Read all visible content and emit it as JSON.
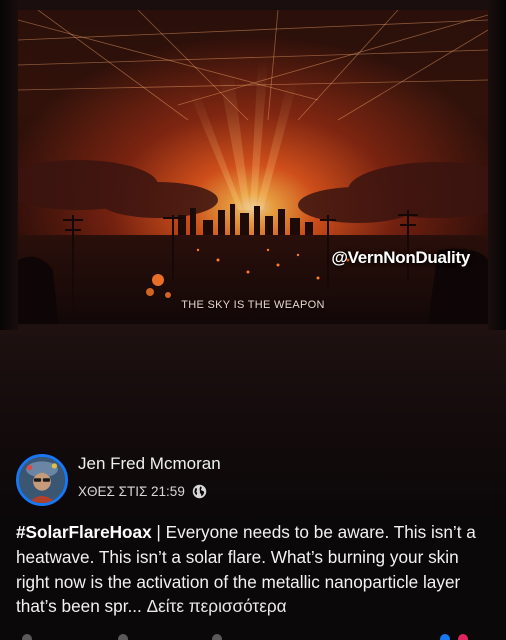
{
  "media": {
    "watermark": "@VernNonDuality",
    "overlay_caption": "THE SKY IS THE WEAPON"
  },
  "post": {
    "author": "Jen Fred Mcmoran",
    "timestamp": "ΧΘΕΣ ΣΤΙΣ 21:59",
    "privacy_icon": "globe-icon",
    "hashtag": "#SolarFlareHoax",
    "text": " | Everyone needs to be aware. This isn’t a heatwave. This isn’t a solar flare. What’s burning your skin right now is the activation of the metallic nanoparticle layer that’s been spr...",
    "see_more": "Δείτε περισσότερα"
  },
  "colors": {
    "accent": "#1877f2",
    "background": "#0b0809",
    "fire": "#ff6a1a"
  }
}
